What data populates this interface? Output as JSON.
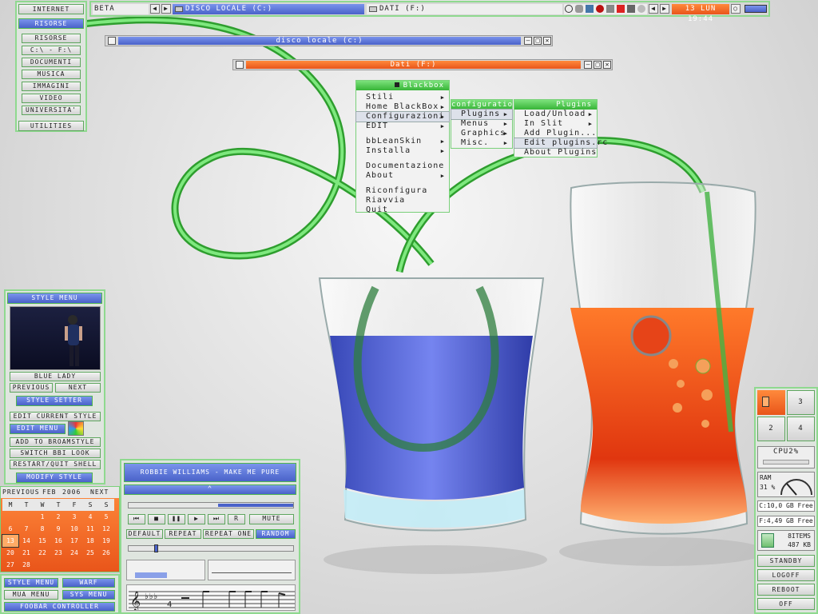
{
  "colors": {
    "accent_blue": "#4a62c9",
    "accent_green": "#37b437",
    "accent_orange": "#f06a28"
  },
  "left_panel": {
    "buttons": [
      "INTERNET",
      "RISORSE",
      "RISORSE",
      "C:\\ - F:\\",
      "DOCUMENTI",
      "MUSICA",
      "IMMAGINI",
      "VIDEO",
      "UNIVERSITA'",
      "UTILITIES"
    ]
  },
  "taskbar": {
    "workspace": "BETA",
    "tasks": [
      "DISCO LOCALE (C:)",
      "DATI (F:)"
    ],
    "clock": "13 LUN 19:44"
  },
  "windows": {
    "c": {
      "title": "disco locale (c:)"
    },
    "f": {
      "title": "Dati (F:)"
    }
  },
  "menu": {
    "title": "Blackbox",
    "items": [
      "Stili",
      "Home BlackBox",
      "Configurazioni",
      "EDIT",
      "bbLeanSkin",
      "Installa",
      "Documentazione",
      "About",
      "Riconfigura",
      "Riavvia",
      "Quit"
    ],
    "config": {
      "title": "configuration",
      "items": [
        "Plugins",
        "Menus",
        "Graphics",
        "Misc."
      ]
    },
    "plugins": {
      "title": "Plugins",
      "items": [
        "Load/Unload",
        "In Slit",
        "Add Plugin...",
        "Edit plugins.rc",
        "About Plugins"
      ]
    }
  },
  "style_panel": {
    "title": "STYLE MENU",
    "style_name": "BLUE LADY",
    "prev": "PREVIOUS",
    "next": "NEXT",
    "setter": "STYLE SETTER",
    "edit_current": "EDIT CURRENT STYLE",
    "edit_menu": "EDIT MENU",
    "add_broam": "ADD TO BROAMSTYLE",
    "switch_look": "SWITCH BBI LOOK",
    "restart": "RESTART/QUIT SHELL",
    "modify": "MODIFY STYLE"
  },
  "calendar": {
    "prev": "PREVIOUS",
    "month": "FEB",
    "year": "2006",
    "next": "NEXT",
    "weekdays": [
      "M",
      "T",
      "W",
      "T",
      "F",
      "S",
      "S"
    ],
    "weeks": [
      [
        "",
        "",
        "1",
        "2",
        "3",
        "4",
        "5"
      ],
      [
        "6",
        "7",
        "8",
        "9",
        "10",
        "11",
        "12"
      ],
      [
        "13",
        "14",
        "15",
        "16",
        "17",
        "18",
        "19"
      ],
      [
        "20",
        "21",
        "22",
        "23",
        "24",
        "25",
        "26"
      ],
      [
        "27",
        "28",
        "",
        "",
        "",
        "",
        ""
      ]
    ],
    "today": "13"
  },
  "bottom_left": {
    "style_menu": "STYLE MENU",
    "warf": "WARF",
    "mua_menu": "MUA MENU",
    "sys_menu": "SYS MENU",
    "foobar": "FOOBAR CONTROLLER"
  },
  "player": {
    "track": "ROBBIE WILLIAMS - MAKE ME PURE",
    "mute": "MUTE",
    "default": "DEFAULT",
    "repeat": "REPEAT",
    "repeat_one": "REPEAT ONE",
    "random": "RANDOM"
  },
  "right_panel": {
    "workspaces": [
      "",
      "3",
      "2",
      "4"
    ],
    "cpu": "CPU2%",
    "ram_label": "RAM",
    "ram_value": "31 %",
    "c_free": "C:10,0 GB Free",
    "f_free": "F:4,49 GB Free",
    "bin_items": "8ITEMS",
    "bin_size": "487 KB",
    "standby": "STANDBY",
    "logoff": "LOGOFF",
    "reboot": "REBOOT",
    "off": "OFF"
  }
}
